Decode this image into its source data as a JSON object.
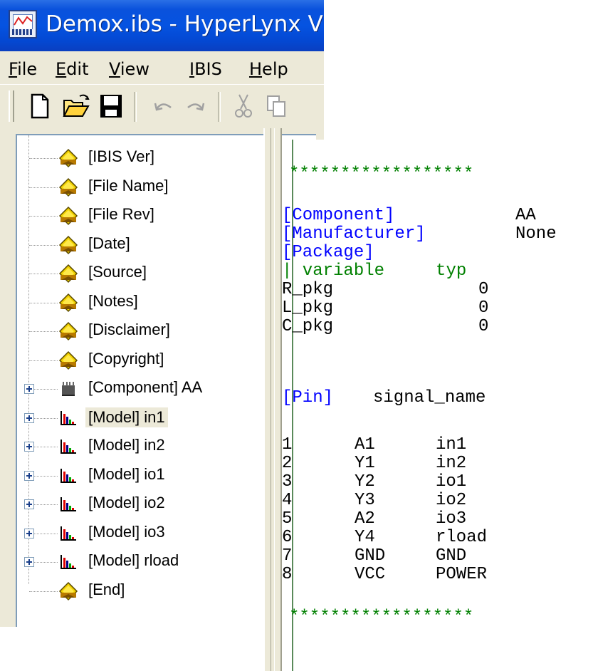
{
  "window": {
    "title": "Demox.ibs - HyperLynx V"
  },
  "menu": [
    {
      "label": "File",
      "underline": "F",
      "rest": "ile"
    },
    {
      "label": "Edit",
      "underline": "E",
      "rest": "dit"
    },
    {
      "label": "View",
      "underline": "V",
      "rest": "iew"
    },
    {
      "label": "IBIS",
      "underline": "I",
      "rest": "BIS"
    },
    {
      "label": "Help",
      "underline": "H",
      "rest": "elp"
    }
  ],
  "tree": {
    "items": [
      {
        "label": "[IBIS Ver]",
        "icon": "keyword-icon"
      },
      {
        "label": "[File Name]",
        "icon": "keyword-icon"
      },
      {
        "label": "[File Rev]",
        "icon": "keyword-icon"
      },
      {
        "label": "[Date]",
        "icon": "keyword-icon"
      },
      {
        "label": "[Source]",
        "icon": "keyword-icon"
      },
      {
        "label": "[Notes]",
        "icon": "keyword-icon"
      },
      {
        "label": "[Disclaimer]",
        "icon": "keyword-icon"
      },
      {
        "label": "[Copyright]",
        "icon": "keyword-icon"
      },
      {
        "label": "[Component] AA",
        "icon": "chip-icon"
      },
      {
        "label": "[Model] in1",
        "icon": "model-chart-icon",
        "selected": true
      },
      {
        "label": "[Model] in2",
        "icon": "model-chart-icon"
      },
      {
        "label": "[Model] io1",
        "icon": "model-chart-icon"
      },
      {
        "label": "[Model] io2",
        "icon": "model-chart-icon"
      },
      {
        "label": "[Model] io3",
        "icon": "model-chart-icon"
      },
      {
        "label": "[Model] rload",
        "icon": "model-chart-icon"
      },
      {
        "label": "[End]",
        "icon": "keyword-icon"
      }
    ]
  },
  "editor": {
    "separator": "******************",
    "component_kw": "[Component]",
    "component_val": "AA",
    "manufacturer_kw": "[Manufacturer]",
    "manufacturer_val": "None",
    "package_kw": "[Package]",
    "package_header": "| variable     typ",
    "r_pkg": "R_pkg",
    "r_pkg_val": "0",
    "l_pkg": "L_pkg",
    "l_pkg_val": "0",
    "c_pkg": "C_pkg",
    "c_pkg_val": "0",
    "pin_kw": "[Pin]",
    "pin_header": "signal_name",
    "pins": [
      {
        "num": "1",
        "sig": "A1",
        "model": "in1"
      },
      {
        "num": "2",
        "sig": "Y1",
        "model": "in2"
      },
      {
        "num": "3",
        "sig": "Y2",
        "model": "io1"
      },
      {
        "num": "4",
        "sig": "Y3",
        "model": "io2"
      },
      {
        "num": "5",
        "sig": "A2",
        "model": "io3"
      },
      {
        "num": "6",
        "sig": "Y4",
        "model": "rload"
      },
      {
        "num": "7",
        "sig": "GND",
        "model": "GND"
      },
      {
        "num": "8",
        "sig": "VCC",
        "model": "POWER"
      }
    ]
  },
  "colors": {
    "keyword": "#0000ff",
    "comment": "#008000",
    "titlebar": "#0553e1"
  }
}
